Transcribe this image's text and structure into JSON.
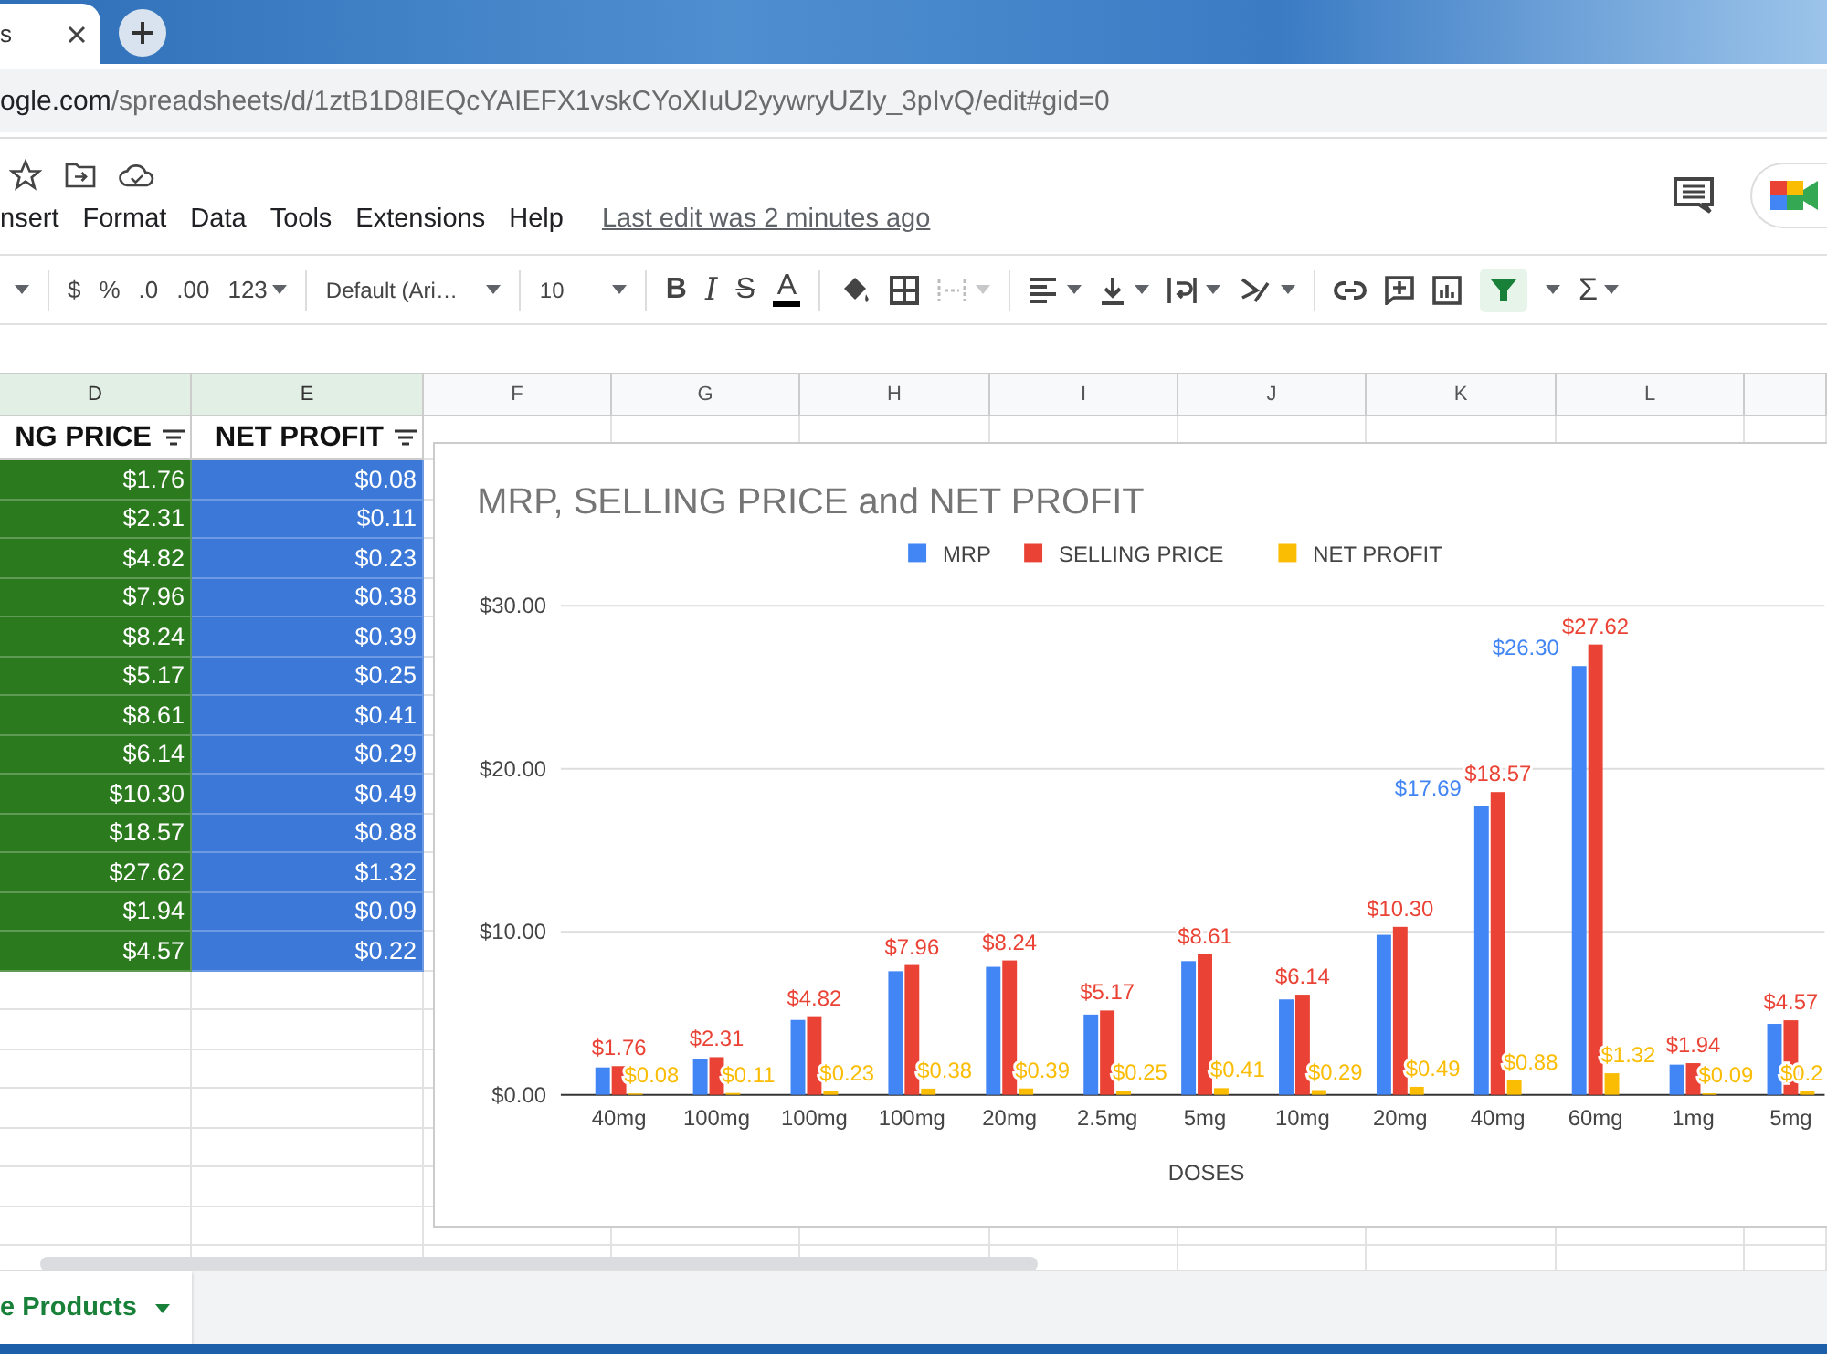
{
  "browser": {
    "tab_title": "s",
    "url_host": "ogle.com",
    "url_path": "/spreadsheets/d/1ztB1D8IEQcYAIEFX1vskCYoXIuU2yywryUZIy_3pIvQ/edit#gid=0"
  },
  "menu": [
    "nsert",
    "Format",
    "Data",
    "Tools",
    "Extensions",
    "Help"
  ],
  "last_edit": "Last edit was 2 minutes ago",
  "toolbar": {
    "currency": "$",
    "percent": "%",
    "decimals_less": ".0",
    "decimals_more": ".00",
    "number_format": "123",
    "font": "Default (Ari…",
    "font_size": "10",
    "bold": "B",
    "italic": "I",
    "strike": "S",
    "text_color": "A",
    "functions": "Σ",
    "merge_disabled": true,
    "filter_on": true
  },
  "grid": {
    "columns": [
      {
        "letter": "D",
        "selected": true
      },
      {
        "letter": "E",
        "selected": true
      },
      {
        "letter": "F",
        "selected": false
      },
      {
        "letter": "G",
        "selected": false
      },
      {
        "letter": "H",
        "selected": false
      },
      {
        "letter": "I",
        "selected": false
      },
      {
        "letter": "J",
        "selected": false
      },
      {
        "letter": "K",
        "selected": false
      },
      {
        "letter": "L",
        "selected": false
      }
    ],
    "data_columns": [
      {
        "header": "NG PRICE",
        "color": "#2b7a1e",
        "cells": [
          "$1.76",
          "$2.31",
          "$4.82",
          "$7.96",
          "$8.24",
          "$5.17",
          "$8.61",
          "$6.14",
          "$10.30",
          "$18.57",
          "$27.62",
          "$1.94",
          "$4.57"
        ]
      },
      {
        "header": "NET PROFIT",
        "color": "#3c78d8",
        "cells": [
          "$0.08",
          "$0.11",
          "$0.23",
          "$0.38",
          "$0.39",
          "$0.25",
          "$0.41",
          "$0.29",
          "$0.49",
          "$0.88",
          "$1.32",
          "$0.09",
          "$0.22"
        ]
      }
    ]
  },
  "chart": {
    "chart_data": {
      "type": "bar",
      "title": "MRP, SELLING PRICE and NET PROFIT",
      "xlabel": "DOSES",
      "categories": [
        "40mg",
        "100mg",
        "100mg",
        "100mg",
        "20mg",
        "2.5mg",
        "5mg",
        "10mg",
        "20mg",
        "40mg",
        "60mg",
        "1mg",
        "5mg"
      ],
      "series": [
        {
          "name": "MRP",
          "color": "#4285f4",
          "values": [
            1.68,
            2.2,
            4.59,
            7.58,
            7.85,
            4.92,
            8.2,
            5.85,
            9.81,
            17.69,
            26.3,
            1.85,
            4.35
          ]
        },
        {
          "name": "SELLING PRICE",
          "color": "#ea4335",
          "values": [
            1.76,
            2.31,
            4.82,
            7.96,
            8.24,
            5.17,
            8.61,
            6.14,
            10.3,
            18.57,
            27.62,
            1.94,
            4.57
          ]
        },
        {
          "name": "NET PROFIT",
          "color": "#fbbc04",
          "values": [
            0.08,
            0.11,
            0.23,
            0.38,
            0.39,
            0.25,
            0.41,
            0.29,
            0.49,
            0.88,
            1.32,
            0.09,
            0.22
          ]
        }
      ],
      "legend": "top",
      "ylim": [
        0,
        30
      ],
      "yticks": [
        {
          "value": 0,
          "label": "$0.00"
        },
        {
          "value": 10,
          "label": "$10.00"
        },
        {
          "value": 20,
          "label": "$20.00"
        },
        {
          "value": 30,
          "label": "$30.00"
        }
      ],
      "value_labels": [
        [
          null,
          null,
          null,
          null,
          null,
          null,
          null,
          null,
          null,
          "$17.69",
          "$26.30",
          null,
          null
        ],
        [
          "$1.76",
          "$2.31",
          "$4.82",
          "$7.96",
          "$8.24",
          "$5.17",
          "$8.61",
          "$6.14",
          "$10.30",
          "$18.57",
          "$27.62",
          "$1.94",
          "$4.57"
        ],
        [
          "$0.08",
          "$0.11",
          "$0.23",
          "$0.38",
          "$0.39",
          "$0.25",
          "$0.41",
          "$0.29",
          "$0.49",
          "$0.88",
          "$1.32",
          "$0.09",
          "$0.2"
        ]
      ]
    }
  },
  "sheet_tab": {
    "label": "e Products",
    "selected": true
  }
}
